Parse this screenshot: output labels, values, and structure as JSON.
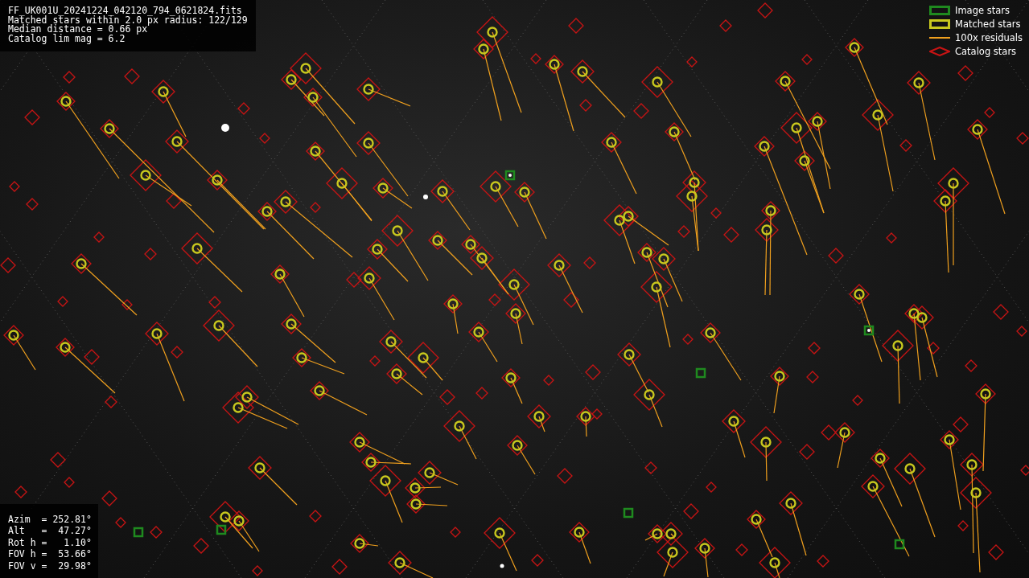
{
  "info_box": {
    "lines": [
      "FF_UK001U_20241224_042120_794_0621824.fits",
      "Matched stars within 2.0 px radius: 122/129",
      "Median distance = 0.66 px",
      "Catalog lim mag = 6.2"
    ]
  },
  "legend": {
    "items": [
      {
        "label": "Image stars",
        "kind": "image",
        "color": "#1f8a1f"
      },
      {
        "label": "Matched stars",
        "kind": "matched",
        "color": "#c8c81e"
      },
      {
        "label": "100x residuals",
        "kind": "residual",
        "color": "#f0a01e"
      },
      {
        "label": "Catalog stars",
        "kind": "catalog",
        "color": "#c81414"
      }
    ]
  },
  "pointing": {
    "lines": [
      "Azim  = 252.81°",
      "Alt   =  47.27°",
      "Rot h =   1.10°",
      "FOV h =  53.66°",
      "FOV v =  29.98°"
    ]
  }
}
